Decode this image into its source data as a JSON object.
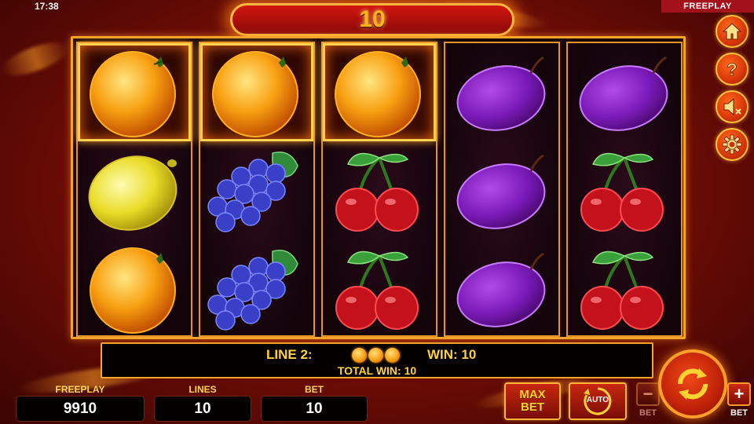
{
  "status_bar": {
    "time": "17:38",
    "mode": "FREEPLAY"
  },
  "win_counter": "10",
  "reels": [
    [
      "orange",
      "lemon",
      "orange"
    ],
    [
      "orange",
      "grapes",
      "grapes"
    ],
    [
      "orange",
      "cherry",
      "cherry"
    ],
    [
      "plum",
      "plum",
      "plum"
    ],
    [
      "plum",
      "cherry",
      "cherry"
    ]
  ],
  "winning_cells": [
    "reel1-row1",
    "reel2-row1",
    "reel3-row1"
  ],
  "side_menu": [
    "home-icon",
    "help-icon",
    "sound-muted-icon",
    "settings-icon"
  ],
  "win_panel": {
    "line_label": "LINE 2:",
    "line_symbols": [
      "orange",
      "orange",
      "orange"
    ],
    "win_label": "WIN: 10",
    "total_win": "TOTAL WIN: 10"
  },
  "stats": {
    "freeplay": {
      "label": "FREEPLAY",
      "value": "9910"
    },
    "lines": {
      "label": "LINES",
      "value": "10"
    },
    "bet": {
      "label": "BET",
      "value": "10"
    }
  },
  "controls": {
    "max_bet_top": "MAX",
    "max_bet_bottom": "BET",
    "auto": "AUTO",
    "bet_minus_sign": "−",
    "bet_minus_label": "BET",
    "bet_plus_sign": "+",
    "bet_plus_label": "BET"
  },
  "colors": {
    "accent": "#f7a42a",
    "background": "#9a1408",
    "text_gold": "#ffd23a"
  }
}
